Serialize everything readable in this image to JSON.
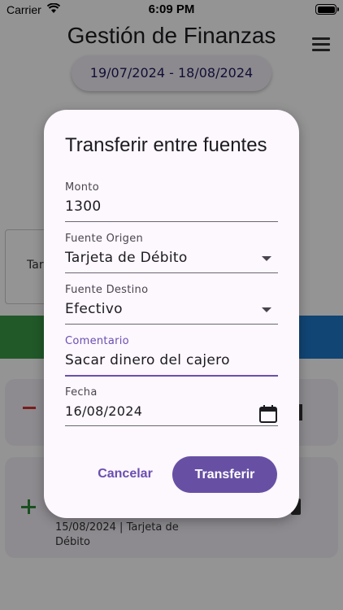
{
  "status": {
    "carrier": "Carrier",
    "time": "6:09 PM"
  },
  "app": {
    "title": "Gestión de Finanzas",
    "date_range": "19/07/2024 - 18/08/2024",
    "card_label": "Tar",
    "row2_sub": "15/08/2024 | Tarjeta de Débito"
  },
  "dialog": {
    "title": "Transferir entre fuentes",
    "fields": [
      {
        "label": "Monto",
        "value": "1300"
      },
      {
        "label": "Fuente Origen",
        "value": "Tarjeta de Débito"
      },
      {
        "label": "Fuente Destino",
        "value": "Efectivo"
      },
      {
        "label": "Comentario",
        "value": "Sacar dinero del cajero"
      },
      {
        "label": "Fecha",
        "value": "16/08/2024"
      }
    ],
    "cancel_label": "Cancelar",
    "confirm_label": "Transferir"
  },
  "colors": {
    "accent": "#6750a4",
    "income": "#3a9a47",
    "transfer": "#1e78c8",
    "expense": "#d32f2f"
  }
}
